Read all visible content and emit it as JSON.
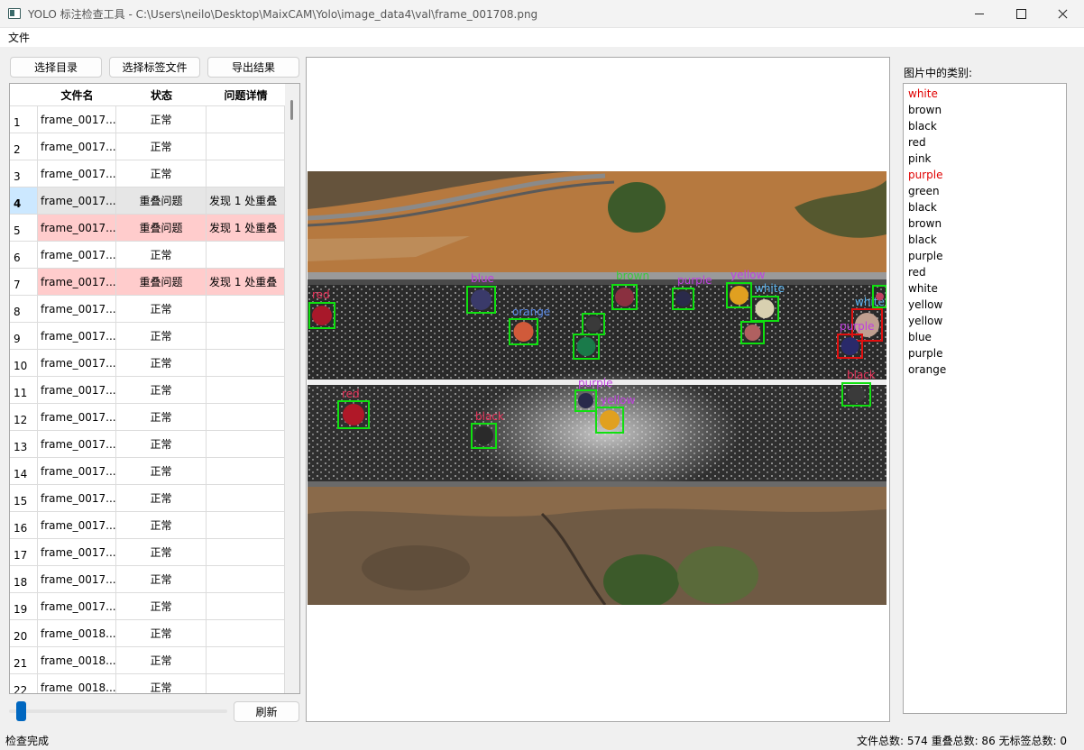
{
  "window": {
    "title": "YOLO 标注检查工具 - C:\\Users\\neilo\\Desktop\\MaixCAM\\Yolo\\image_data4\\val\\frame_001708.png"
  },
  "menu": {
    "file": "文件"
  },
  "toolbar": {
    "select_dir": "选择目录",
    "select_label_file": "选择标签文件",
    "export": "导出结果"
  },
  "table": {
    "headers": [
      "文件名",
      "状态",
      "问题详情"
    ],
    "rows": [
      {
        "idx": "1",
        "name": "frame_0017...",
        "status": "正常",
        "detail": ""
      },
      {
        "idx": "2",
        "name": "frame_0017...",
        "status": "正常",
        "detail": ""
      },
      {
        "idx": "3",
        "name": "frame_0017...",
        "status": "正常",
        "detail": ""
      },
      {
        "idx": "4",
        "name": "frame_0017...",
        "status": "重叠问题",
        "detail": "发现 1 处重叠"
      },
      {
        "idx": "5",
        "name": "frame_0017...",
        "status": "重叠问题",
        "detail": "发现 1 处重叠"
      },
      {
        "idx": "6",
        "name": "frame_0017...",
        "status": "正常",
        "detail": ""
      },
      {
        "idx": "7",
        "name": "frame_0017...",
        "status": "重叠问题",
        "detail": "发现 1 处重叠"
      },
      {
        "idx": "8",
        "name": "frame_0017...",
        "status": "正常",
        "detail": ""
      },
      {
        "idx": "9",
        "name": "frame_0017...",
        "status": "正常",
        "detail": ""
      },
      {
        "idx": "10",
        "name": "frame_0017...",
        "status": "正常",
        "detail": ""
      },
      {
        "idx": "11",
        "name": "frame_0017...",
        "status": "正常",
        "detail": ""
      },
      {
        "idx": "12",
        "name": "frame_0017...",
        "status": "正常",
        "detail": ""
      },
      {
        "idx": "13",
        "name": "frame_0017...",
        "status": "正常",
        "detail": ""
      },
      {
        "idx": "14",
        "name": "frame_0017...",
        "status": "正常",
        "detail": ""
      },
      {
        "idx": "15",
        "name": "frame_0017...",
        "status": "正常",
        "detail": ""
      },
      {
        "idx": "16",
        "name": "frame_0017...",
        "status": "正常",
        "detail": ""
      },
      {
        "idx": "17",
        "name": "frame_0017...",
        "status": "正常",
        "detail": ""
      },
      {
        "idx": "18",
        "name": "frame_0017...",
        "status": "正常",
        "detail": ""
      },
      {
        "idx": "19",
        "name": "frame_0017...",
        "status": "正常",
        "detail": ""
      },
      {
        "idx": "20",
        "name": "frame_0018...",
        "status": "正常",
        "detail": ""
      },
      {
        "idx": "21",
        "name": "frame_0018...",
        "status": "正常",
        "detail": ""
      },
      {
        "idx": "22",
        "name": "frame_0018...",
        "status": "正常",
        "detail": ""
      }
    ]
  },
  "refresh_label": "刷新",
  "classes_title": "图片中的类别:",
  "classes": [
    {
      "name": "white",
      "dup": true
    },
    {
      "name": "brown",
      "dup": false
    },
    {
      "name": "black",
      "dup": false
    },
    {
      "name": "red",
      "dup": false
    },
    {
      "name": "pink",
      "dup": false
    },
    {
      "name": "purple",
      "dup": true
    },
    {
      "name": "green",
      "dup": false
    },
    {
      "name": "black",
      "dup": false
    },
    {
      "name": "brown",
      "dup": false
    },
    {
      "name": "black",
      "dup": false
    },
    {
      "name": "purple",
      "dup": false
    },
    {
      "name": "red",
      "dup": false
    },
    {
      "name": "white",
      "dup": false
    },
    {
      "name": "yellow",
      "dup": false
    },
    {
      "name": "yellow",
      "dup": false
    },
    {
      "name": "blue",
      "dup": false
    },
    {
      "name": "purple",
      "dup": false
    },
    {
      "name": "orange",
      "dup": false
    }
  ],
  "detections": [
    {
      "label": "red",
      "label_color": "#e8325a",
      "box": "green"
    },
    {
      "label": "blue",
      "label_color": "#c040e0",
      "box": "green"
    },
    {
      "label": "orange",
      "label_color": "#5a8ae8",
      "box": "green"
    },
    {
      "label": "brown",
      "label_color": "#3cc83c",
      "box": "green"
    },
    {
      "label": "purple",
      "label_color": "#c040e0",
      "box": "green"
    },
    {
      "label": "yellow",
      "label_color": "#c040e0",
      "box": "green"
    },
    {
      "label": "white",
      "label_color": "#5ab4f0",
      "box": "green"
    },
    {
      "label": "white",
      "label_color": "#5ab4f0",
      "box": "red"
    },
    {
      "label": "purple",
      "label_color": "#c040e0",
      "box": "red"
    },
    {
      "label": "black",
      "label_color": "#e8325a",
      "box": "green"
    },
    {
      "label": "red",
      "label_color": "#e8325a",
      "box": "green"
    },
    {
      "label": "purple",
      "label_color": "#c040e0",
      "box": "green"
    },
    {
      "label": "yellow",
      "label_color": "#c040e0",
      "box": "green"
    },
    {
      "label": "black",
      "label_color": "#e8325a",
      "box": "green"
    },
    {
      "label": "",
      "label_color": "#e8325a",
      "box": "green"
    },
    {
      "label": "",
      "label_color": "#e8325a",
      "box": "green"
    },
    {
      "label": "",
      "label_color": "#e8325a",
      "box": "green"
    },
    {
      "label": "",
      "label_color": "#e8325a",
      "box": "green"
    }
  ],
  "status": {
    "left": "检查完成",
    "right": "文件总数: 574  重叠总数: 86  无标签总数: 0"
  }
}
